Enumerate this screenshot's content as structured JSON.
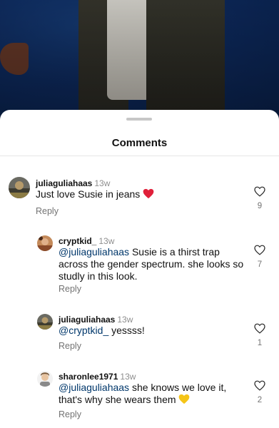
{
  "sheet": {
    "title": "Comments"
  },
  "comments": [
    {
      "username": "juliaguliahaas",
      "time": "13w",
      "text": "Just love Susie in jeans",
      "emoji": "red-heart",
      "reply_label": "Reply",
      "likes": "9"
    },
    {
      "username": "cryptkid_",
      "time": "13w",
      "mention": "@juliaguliahaas",
      "text_line1": " Susie is a thirst trap",
      "text_line2": "across the gender spectrum. she looks so",
      "text_line3": "studly in this look.",
      "reply_label": "Reply",
      "likes": "7"
    },
    {
      "username": "juliaguliahaas",
      "time": "13w",
      "mention": "@cryptkid_",
      "text": " yessss!",
      "reply_label": "Reply",
      "likes": "1"
    },
    {
      "username": "sharonlee1971",
      "time": "13w",
      "mention": "@juliaguliahaas",
      "text_line1": " she knows we love it,",
      "text_line2": "that's why she wears them",
      "emoji": "yellow-heart",
      "reply_label": "Reply",
      "likes": "2"
    }
  ],
  "colors": {
    "mention": "#00376b",
    "muted": "#737373",
    "red_heart": "#e0203a",
    "yellow_heart": "#f5c518"
  }
}
